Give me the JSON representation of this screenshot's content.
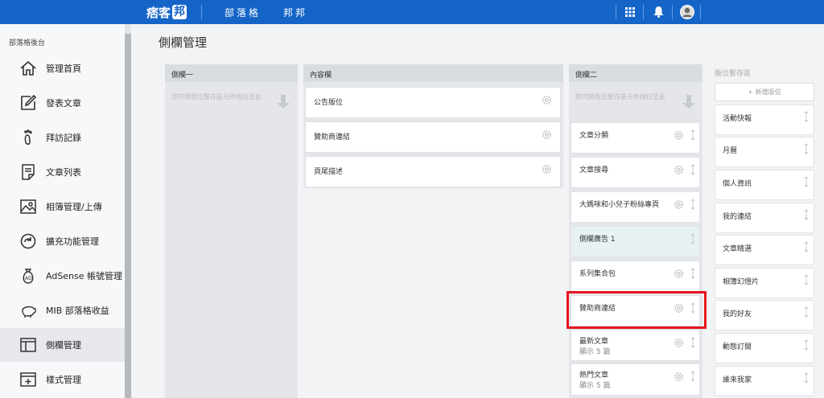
{
  "topbar": {
    "logo_text": "痞客",
    "logo_box": "邦",
    "nav": [
      "部落格",
      "邦邦"
    ],
    "icons": [
      "apps-grid-icon",
      "notification-bell-icon",
      "user-avatar"
    ],
    "color": "#1565c8"
  },
  "sidebar": {
    "heading": "部落格後台",
    "items": [
      {
        "label": "管理首頁",
        "icon": "home-icon"
      },
      {
        "label": "發表文章",
        "icon": "edit-icon"
      },
      {
        "label": "拜訪記錄",
        "icon": "footprint-icon"
      },
      {
        "label": "文章列表",
        "icon": "article-list-icon"
      },
      {
        "label": "相簿管理/上傳",
        "icon": "album-icon"
      },
      {
        "label": "擴充功能管理",
        "icon": "extension-icon"
      },
      {
        "label": "AdSense 帳號管理",
        "icon": "adsense-icon"
      },
      {
        "label": "MIB 部落格收益",
        "icon": "piggy-bank-icon"
      },
      {
        "label": "側欄管理",
        "icon": "sidebar-layout-icon",
        "active": true
      },
      {
        "label": "樣式管理",
        "icon": "style-icon"
      }
    ]
  },
  "main": {
    "title": "側欄管理",
    "columns": {
      "sidebar1": {
        "header": "側欄一",
        "hint": "您可將版位暫存區元件拖拉至此"
      },
      "content": {
        "header": "內容欄",
        "widgets": [
          "公告版位",
          "贊助商連結",
          "頁尾描述"
        ]
      },
      "sidebar2": {
        "header": "側欄二",
        "hint": "您可將版位暫存區元件拖拉至此",
        "widgets": [
          {
            "title": "文章分類",
            "sub": ""
          },
          {
            "title": "文章搜尋",
            "sub": ""
          },
          {
            "title": "大媽咪和小兒子粉絲專頁",
            "sub": ""
          },
          {
            "title": "側欄廣告 1",
            "sub": ""
          },
          {
            "title": "系列集合包",
            "sub": ""
          },
          {
            "title": "贊助商連結",
            "sub": ""
          },
          {
            "title": "最新文章",
            "sub": "顯示 5 篇"
          },
          {
            "title": "熱門文章",
            "sub": "顯示 5 篇"
          }
        ]
      }
    },
    "storage": {
      "title": "版位暫存區",
      "add_label": "+ 新增版位",
      "items": [
        "活動快報",
        "月曆",
        "個人資訊",
        "我的連結",
        "文章精選",
        "相簿幻燈片",
        "我的好友",
        "動態訂閱",
        "誰來我家"
      ]
    }
  }
}
